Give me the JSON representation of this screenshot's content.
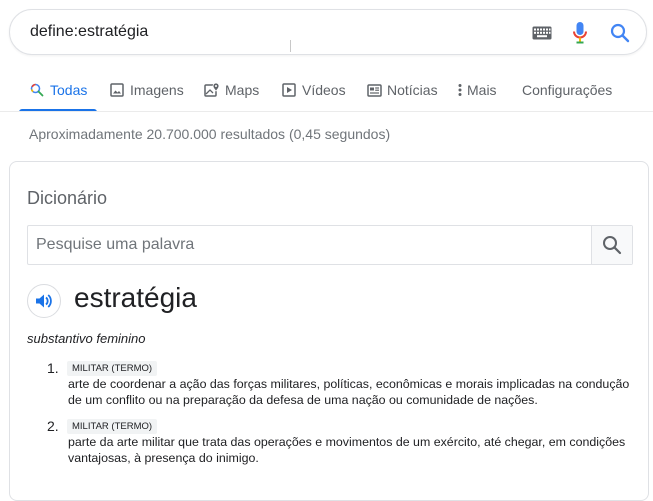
{
  "search": {
    "query": "define:estratégia",
    "keyboard_icon": "keyboard-icon",
    "mic_icon": "microphone-icon",
    "search_icon": "search-icon"
  },
  "tabs": [
    {
      "label": "Todas",
      "icon": "search-icon",
      "active": true
    },
    {
      "label": "Imagens",
      "icon": "image-icon",
      "active": false
    },
    {
      "label": "Maps",
      "icon": "map-icon",
      "active": false
    },
    {
      "label": "Vídeos",
      "icon": "video-icon",
      "active": false
    },
    {
      "label": "Notícias",
      "icon": "news-icon",
      "active": false
    },
    {
      "label": "Mais",
      "icon": "more-vert-icon",
      "active": false
    },
    {
      "label": "Configurações",
      "icon": "",
      "active": false
    }
  ],
  "result_stats": "Aproximadamente 20.700.000 resultados (0,45 segundos)",
  "dictionary": {
    "title": "Dicionário",
    "search_placeholder": "Pesquise uma palavra",
    "word": "estratégia",
    "part_of_speech": "substantivo feminino",
    "senses": [
      {
        "number": "1.",
        "tag": "MILITAR (TERMO)",
        "definition": "arte de coordenar a ação das forças militares, políticas, econômicas e morais implicadas na condução de um conflito ou na preparação da defesa de uma nação ou comunidade de nações."
      },
      {
        "number": "2.",
        "tag": "MILITAR (TERMO)",
        "definition": "parte da arte militar que trata das operações e movimentos de um exército, até chegar, em condições vantajosas, à presença do inimigo."
      }
    ]
  },
  "colors": {
    "accent_blue": "#1a73e8",
    "mic_red": "#ea4335",
    "mic_yellow": "#fbbc04",
    "mic_green": "#34a853",
    "mic_blue": "#4285f4"
  }
}
